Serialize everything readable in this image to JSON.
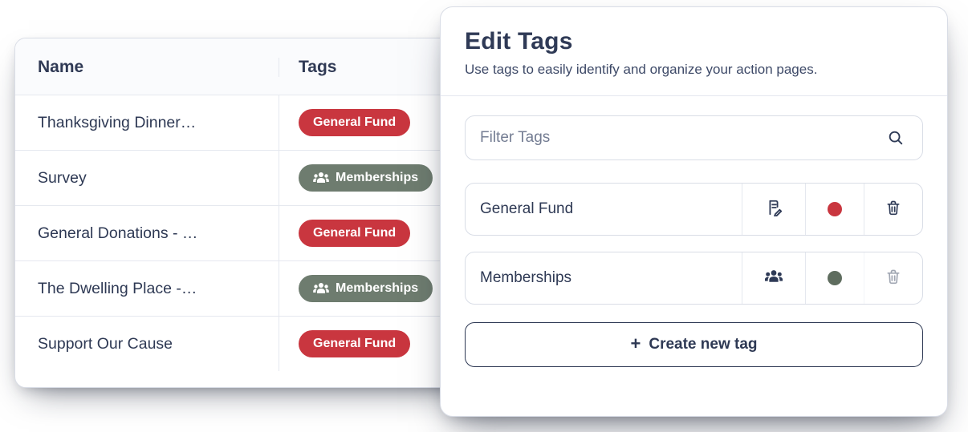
{
  "table": {
    "columns": {
      "name": "Name",
      "tags": "Tags"
    },
    "rows": [
      {
        "name": "Thanksgiving Dinner…",
        "tag": {
          "label": "General Fund",
          "style": "red",
          "icon": null
        }
      },
      {
        "name": "Survey",
        "tag": {
          "label": "Memberships",
          "style": "olive",
          "icon": "people-icon"
        }
      },
      {
        "name": "General Donations - …",
        "tag": {
          "label": "General Fund",
          "style": "red",
          "icon": null
        }
      },
      {
        "name": "The Dwelling Place -…",
        "tag": {
          "label": "Memberships",
          "style": "olive",
          "icon": "people-icon"
        }
      },
      {
        "name": "Support Our Cause",
        "tag": {
          "label": "General Fund",
          "style": "red",
          "icon": null
        }
      }
    ]
  },
  "panel": {
    "title": "Edit Tags",
    "subtitle": "Use tags to easily identify and organize your action pages.",
    "filter_placeholder": "Filter Tags",
    "tags": [
      {
        "name": "General Fund",
        "edit_icon": "edit-icon",
        "color": "#c9363f",
        "dot": "red",
        "trash_ghost": false
      },
      {
        "name": "Memberships",
        "edit_icon": "people-icon",
        "color": "#5f6d5f",
        "dot": "olive",
        "trash_ghost": true
      }
    ],
    "create_label": "Create new tag"
  },
  "colors": {
    "red": "#c9363f",
    "olive": "#6e7c6f",
    "ink": "#2f3a54"
  }
}
